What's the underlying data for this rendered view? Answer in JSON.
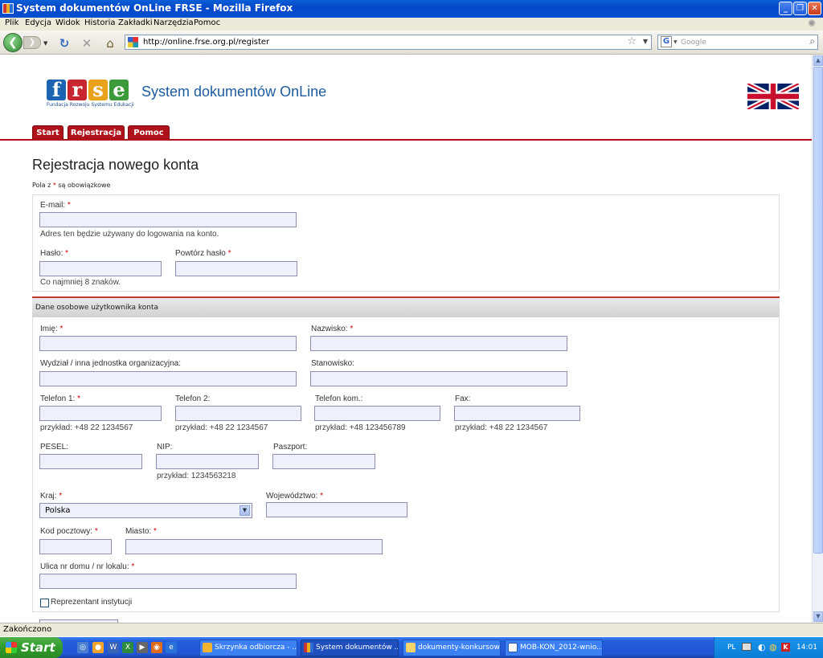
{
  "window": {
    "title": "System dokumentów OnLine FRSE - Mozilla Firefox",
    "minimize": "_",
    "maximize": "❐",
    "close": "✕"
  },
  "menu": [
    "Plik",
    "Edycja",
    "Widok",
    "Historia",
    "Zakładki",
    "Narzędzia",
    "Pomoc"
  ],
  "nav": {
    "url": "http://online.frse.org.pl/register",
    "search_placeholder": "Google"
  },
  "site": {
    "logo_letters": [
      "f",
      "r",
      "s",
      "e"
    ],
    "logo_colors": [
      "#1a64b3",
      "#c7262e",
      "#e8a21c",
      "#3b9b3a"
    ],
    "logo_subtitle": "Fundacja Rozwoju Systemu Edukacji",
    "system_title": "System dokumentów OnLine",
    "tabs": [
      "Start",
      "Rejestracja",
      "Pomoc"
    ]
  },
  "page": {
    "title": "Rejestracja nowego konta",
    "required_note_pre": "Pola z ",
    "required_star": "*",
    "required_note_post": " są obowiązkowe"
  },
  "account": {
    "email_label": "E-mail:",
    "email_hint": "Adres ten będzie używany do logowania na konto.",
    "password_label": "Hasło:",
    "password_repeat_label": "Powtórz hasło",
    "password_hint": "Co najmniej 8 znaków."
  },
  "personal": {
    "section_title": "Dane osobowe użytkownika konta",
    "first_name_label": "Imię:",
    "last_name_label": "Nazwisko:",
    "department_label": "Wydział / inna jednostka organizacyjna:",
    "position_label": "Stanowisko:",
    "phone1_label": "Telefon 1:",
    "phone2_label": "Telefon 2:",
    "mobile_label": "Telefon kom.:",
    "fax_label": "Fax:",
    "phone1_hint": "przykład: +48 22 1234567",
    "phone2_hint": "przykład: +48 22 1234567",
    "mobile_hint": "przykład: +48 123456789",
    "fax_hint": "przykład: +48 22 1234567",
    "pesel_label": "PESEL:",
    "nip_label": "NIP:",
    "nip_hint": "przykład: 1234563218",
    "passport_label": "Paszport:",
    "country_label": "Kraj:",
    "country_value": "Polska",
    "province_label": "Województwo:",
    "postcode_label": "Kod pocztowy:",
    "city_label": "Miasto:",
    "street_label": "Ulica nr domu / nr lokalu:",
    "institution_rep_label": "Reprezentant instytucji"
  },
  "status": "Zakończono",
  "taskbar": {
    "start": "Start",
    "tasks": [
      "Skrzynka odbiorcza - ...",
      "System dokumentów ...",
      "dokumenty-konkursowe",
      "MOB-KON_2012-wnio..."
    ],
    "lang": "PL",
    "clock": "14:01"
  }
}
